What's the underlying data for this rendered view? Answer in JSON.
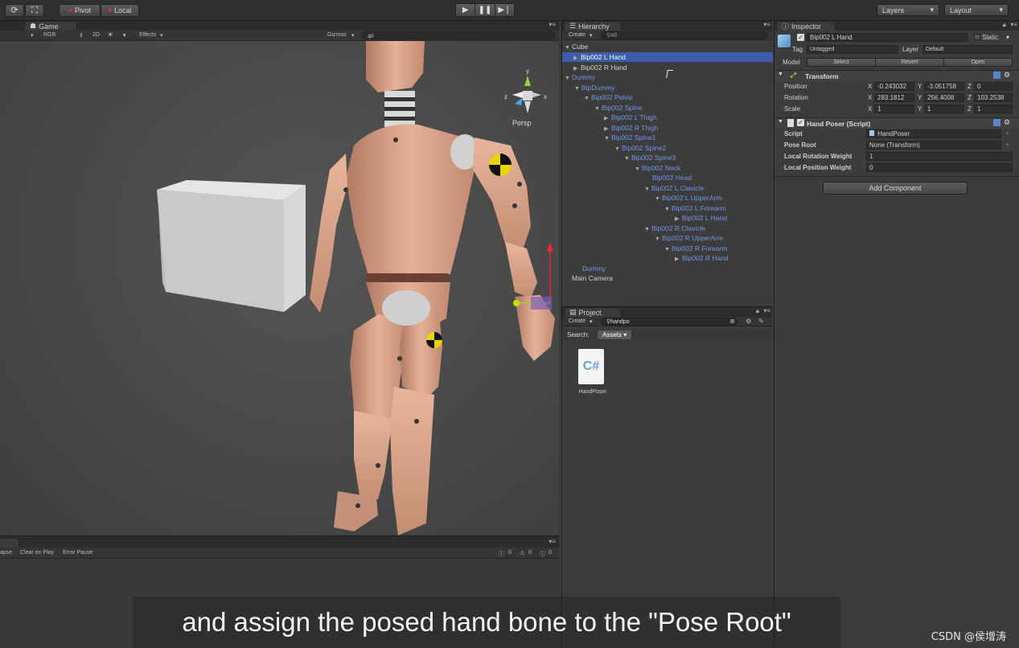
{
  "toolbar": {
    "pivot_label": "Pivot",
    "local_label": "Local",
    "layers_label": "Layers",
    "layout_label": "Layout"
  },
  "game_view": {
    "tab_label": "Game",
    "color_mode": "RGB",
    "mode_2d": "2D",
    "effects_label": "Effects",
    "gizmos_label": "Gizmos",
    "search_placeholder": "All",
    "gizmo_persp": "Persp",
    "gizmo_axis_x": "x",
    "gizmo_axis_y": "y",
    "gizmo_axis_z": "z"
  },
  "console": {
    "collapse_label": "apse",
    "clear_on_play_label": "Clear on Play",
    "error_pause_label": "Error Pause",
    "info_count": "0",
    "warning_count": "0",
    "error_count": "0"
  },
  "hierarchy": {
    "tab_label": "Hierarchy",
    "create_label": "Create",
    "search_placeholder": "All",
    "items": [
      {
        "label": "Cube"
      },
      {
        "label": "Bip002 L Hand"
      },
      {
        "label": "Bip002 R Hand"
      },
      {
        "label": "Dummy"
      },
      {
        "label": "BipDummy"
      },
      {
        "label": "Bip002 Pelvis"
      },
      {
        "label": "Bip002 Spine"
      },
      {
        "label": "Bip002 L Thigh"
      },
      {
        "label": "Bip002 R Thigh"
      },
      {
        "label": "Bip002 Spine1"
      },
      {
        "label": "Bip002 Spine2"
      },
      {
        "label": "Bip002 Spine3"
      },
      {
        "label": "Bip002 Neck"
      },
      {
        "label": "Bip002 Head"
      },
      {
        "label": "Bip002 L Clavicle"
      },
      {
        "label": "Bip002 L UpperArm"
      },
      {
        "label": "Bip002 L Forearm"
      },
      {
        "label": "Bip002 L Hand"
      },
      {
        "label": "Bip002 R Clavicle"
      },
      {
        "label": "Bip002 R UpperArm"
      },
      {
        "label": "Bip002 R Forearm"
      },
      {
        "label": "Bip002 R Hand"
      },
      {
        "label": "Dummy"
      },
      {
        "label": "Main Camera"
      }
    ]
  },
  "project": {
    "tab_label": "Project",
    "create_label": "Create",
    "search_value": "handpo",
    "search_label": "Search:",
    "assets_filter": "Assets",
    "asset_name": "HandPoser",
    "asset_icon_text": "C#"
  },
  "inspector": {
    "tab_label": "Inspector",
    "object_name": "Bip002 L Hand",
    "static_label": "Static",
    "tag_label": "Tag",
    "tag_value": "Untagged",
    "layer_label": "Layer",
    "layer_value": "Default",
    "model_label": "Model",
    "model_select": "Select",
    "model_revert": "Revert",
    "model_open": "Open",
    "transform_title": "Transform",
    "position_label": "Position",
    "rotation_label": "Rotation",
    "scale_label": "Scale",
    "axis_x": "X",
    "axis_y": "Y",
    "axis_z": "Z",
    "position": {
      "x": "-0.243032",
      "y": "-3.051758",
      "z": "0"
    },
    "rotation": {
      "x": "283.1812",
      "y": "256.4008",
      "z": "103.2538"
    },
    "scale": {
      "x": "1",
      "y": "1",
      "z": "1"
    },
    "hand_poser_title": "Hand Poser (Script)",
    "script_label": "Script",
    "script_value": "HandPoser",
    "pose_root_label": "Pose Root",
    "pose_root_value": "None (Transform)",
    "local_rotation_weight_label": "Local Rotation Weight",
    "local_rotation_weight_value": "1",
    "local_position_weight_label": "Local Position Weight",
    "local_position_weight_value": "0",
    "add_component_label": "Add Component"
  },
  "subtitle": "and assign the posed hand bone to the \"Pose Root\"",
  "watermark": "CSDN @侯增涛"
}
